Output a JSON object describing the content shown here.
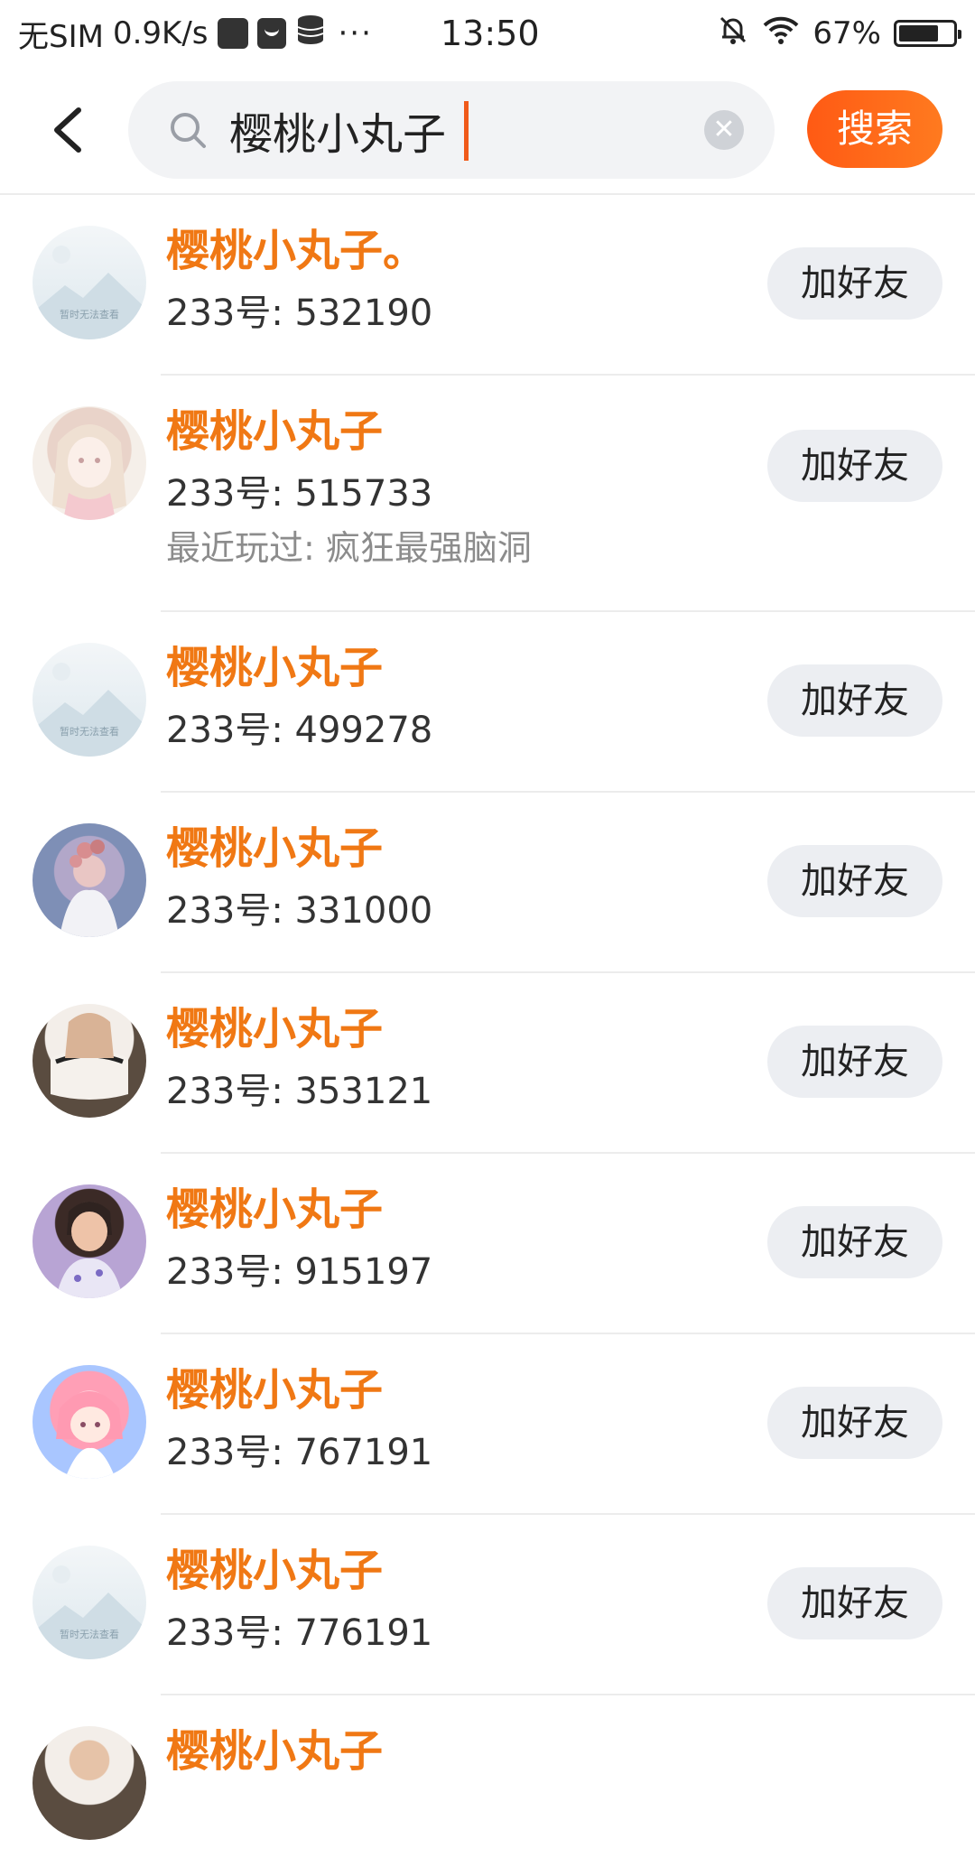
{
  "status_bar": {
    "carrier": "无SIM",
    "speed": "0.9K/s",
    "more": "···",
    "time": "13:50",
    "battery": "67%",
    "icons": [
      "square-icon",
      "mail-icon",
      "database-icon",
      "mute-bell-icon",
      "wifi-icon",
      "battery-icon"
    ]
  },
  "search": {
    "query": "樱桃小丸子",
    "search_button": "搜索"
  },
  "results": [
    {
      "name": "樱桃小丸子。",
      "account": "233号: 532190",
      "recent": "",
      "avatar": "placeholder",
      "action": "加好友"
    },
    {
      "name": "樱桃小丸子",
      "account": "233号: 515733",
      "recent": "最近玩过: 疯狂最强脑洞",
      "avatar": "photo",
      "action": "加好友"
    },
    {
      "name": "樱桃小丸子",
      "account": "233号: 499278",
      "recent": "",
      "avatar": "placeholder",
      "action": "加好友"
    },
    {
      "name": "樱桃小丸子",
      "account": "233号: 331000",
      "recent": "",
      "avatar": "photo",
      "action": "加好友"
    },
    {
      "name": "樱桃小丸子",
      "account": "233号: 353121",
      "recent": "",
      "avatar": "photo",
      "action": "加好友"
    },
    {
      "name": "樱桃小丸子",
      "account": "233号: 915197",
      "recent": "",
      "avatar": "photo",
      "action": "加好友"
    },
    {
      "name": "樱桃小丸子",
      "account": "233号: 767191",
      "recent": "",
      "avatar": "photo",
      "action": "加好友"
    },
    {
      "name": "樱桃小丸子",
      "account": "233号: 776191",
      "recent": "",
      "avatar": "placeholder",
      "action": "加好友"
    }
  ],
  "placeholder_avatar_text": "暂时无法查看",
  "colors": {
    "accent": "#f07814",
    "search_button": "#ff5a14",
    "button_bg": "#eceef2"
  }
}
